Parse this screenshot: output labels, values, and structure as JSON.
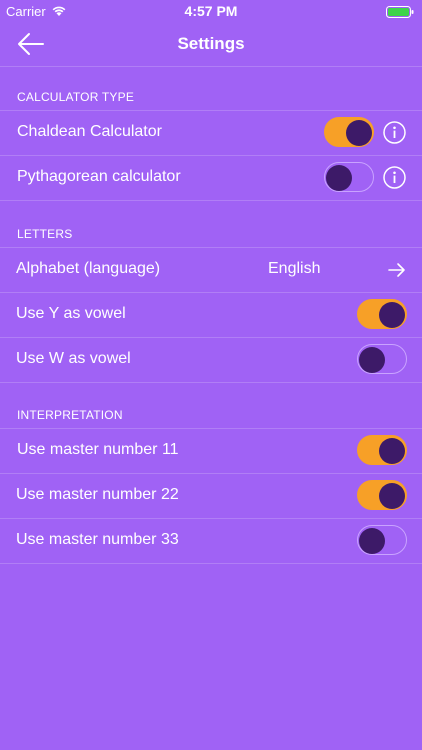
{
  "status_bar": {
    "carrier": "Carrier",
    "time": "4:57 PM",
    "icons": [
      "wifi-icon",
      "battery-icon"
    ]
  },
  "navbar": {
    "title": "Settings",
    "back_icon": "arrow-left-icon"
  },
  "sections": {
    "calculator_type": {
      "header": "CALCULATOR TYPE",
      "rows": [
        {
          "label": "Chaldean Calculator",
          "on": true,
          "info_icon": "info-icon"
        },
        {
          "label": "Pythagorean calculator",
          "on": false,
          "info_icon": "info-icon"
        }
      ]
    },
    "letters": {
      "header": "LETTERS",
      "alphabet": {
        "label": "Alphabet (language)",
        "value": "English",
        "icon": "arrow-right-icon"
      },
      "rows": [
        {
          "label": "Use Y as vowel",
          "on": true
        },
        {
          "label": "Use W as vowel",
          "on": false
        }
      ]
    },
    "interpretation": {
      "header": "INTERPRETATION",
      "rows": [
        {
          "label": "Use master number 11",
          "on": true
        },
        {
          "label": "Use master number 22",
          "on": true
        },
        {
          "label": "Use master number 33",
          "on": false
        }
      ]
    }
  },
  "colors": {
    "background": "#a062f5",
    "toggle_on": "#f7a027",
    "knob": "#3d1a68",
    "text": "#ffffff"
  }
}
